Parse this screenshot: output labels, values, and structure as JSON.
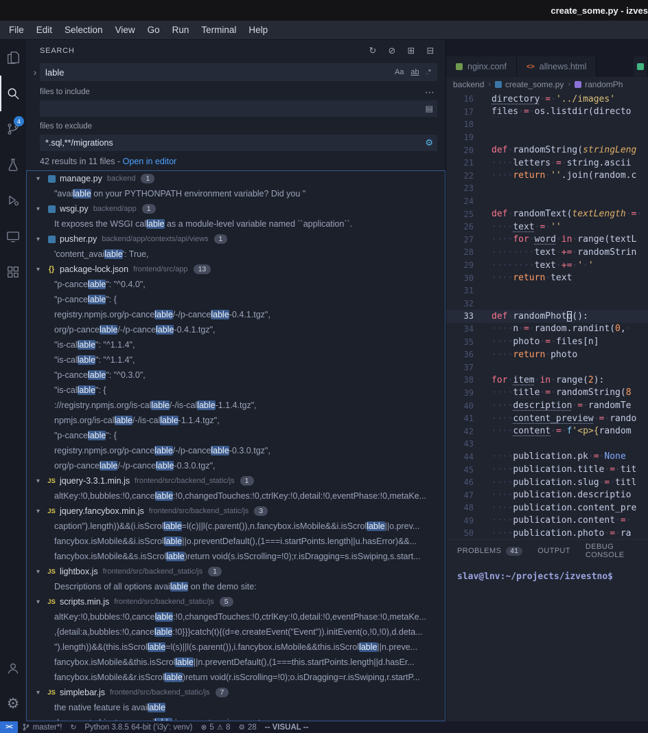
{
  "window": {
    "title": "create_some.py - izves",
    "menus": [
      "File",
      "Edit",
      "Selection",
      "View",
      "Go",
      "Run",
      "Terminal",
      "Help"
    ]
  },
  "activity": {
    "scm_badge": "4"
  },
  "icons": {
    "refresh": "↻",
    "clear_results": "⊘",
    "new_search_editor": "⊞",
    "collapse_all": "⊟",
    "toggle_replace": "›",
    "ellipsis": "⋯",
    "open_editors": "▤",
    "gear": "⚙",
    "match_case": "Aa",
    "whole_word": "ab",
    "regex": ".*",
    "chevron_down": "▾",
    "error": "⊗",
    "warning": "⚠",
    "sync": "↻",
    "remote": "><"
  },
  "search": {
    "panel_title": "SEARCH",
    "query": "lable",
    "include_label": "files to include",
    "include_value": "",
    "exclude_label": "files to exclude",
    "exclude_value": "*.sql,**/migrations",
    "summary": "42 results in 11 files - ",
    "open_in_editor": "Open in editor",
    "results": [
      {
        "type": "py",
        "name": "manage.py",
        "path": "backend",
        "count": "1",
        "matches": [
          "\"available on your PYTHONPATH environment variable? Did you \""
        ]
      },
      {
        "type": "py",
        "name": "wsgi.py",
        "path": "backend/app",
        "count": "1",
        "matches": [
          "It exposes the WSGI callable as a module-level variable named ``application``."
        ]
      },
      {
        "type": "py",
        "name": "pusher.py",
        "path": "backend/app/contexts/api/views",
        "count": "1",
        "matches": [
          "'content_available': True,"
        ]
      },
      {
        "type": "json",
        "name": "package-lock.json",
        "path": "frontend/src/app",
        "count": "13",
        "matches": [
          "\"p-cancelable\": \"^0.4.0\",",
          "\"p-cancelable\": {",
          "registry.npmjs.org/p-cancelable/-/p-cancelable-0.4.1.tgz\",",
          "org/p-cancelable/-/p-cancelable-0.4.1.tgz\",",
          "\"is-callable\": \"^1.1.4\",",
          "\"is-callable\": \"^1.1.4\",",
          "\"p-cancelable\": \"^0.3.0\",",
          "\"is-callable\": {",
          "://registry.npmjs.org/is-callable/-/is-callable-1.1.4.tgz\",",
          "npmjs.org/is-callable/-/is-callable-1.1.4.tgz\",",
          "\"p-cancelable\": {",
          "registry.npmjs.org/p-cancelable/-/p-cancelable-0.3.0.tgz\",",
          "org/p-cancelable/-/p-cancelable-0.3.0.tgz\","
        ]
      },
      {
        "type": "js",
        "name": "jquery-3.3.1.min.js",
        "path": "frontend/src/backend_static/js",
        "count": "1",
        "matches": [
          "altKey:!0,bubbles:!0,cancelable:!0,changedTouches:!0,ctrlKey:!0,detail:!0,eventPhase:!0,metaKe..."
        ]
      },
      {
        "type": "js",
        "name": "jquery.fancybox.min.js",
        "path": "frontend/src/backend_static/js",
        "count": "3",
        "matches": [
          "caption\").length))&&(i.isScrollable=l(c)||l(c.parent()),n.fancybox.isMobile&&i.isScrollable||o.prev...",
          "fancybox.isMobile&&i.isScrollable||o.preventDefault(),(1===i.startPoints.length||u.hasError)&&...",
          "fancybox.isMobile&&s.isScrollable)return void(s.isScrolling=!0);r.isDragging=s.isSwiping,s.start..."
        ]
      },
      {
        "type": "js",
        "name": "lightbox.js",
        "path": "frontend/src/backend_static/js",
        "count": "1",
        "matches": [
          "Descriptions of all options available on the demo site:"
        ]
      },
      {
        "type": "js",
        "name": "scripts.min.js",
        "path": "frontend/src/backend_static/js",
        "count": "5",
        "matches": [
          "altKey:!0,bubbles:!0,cancelable:!0,changedTouches:!0,ctrlKey:!0,detail:!0,eventPhase:!0,metaKe...",
          ",{detail:a,bubbles:!0,cancelable:!0}}}catch(t){(d=e.createEvent(\"Event\")).initEvent(o,!0,!0),d.deta...",
          "\").length))&&(this.isScrollable=l(s)||l(s.parent()),i.fancybox.isMobile&&this.isScrollable||n.preve...",
          "fancybox.isMobile&&this.isScrollable||n.preventDefault(),(1===this.startPoints.length||d.hasEr...",
          "fancybox.isMobile&&r.isScrollable)return void(r.isScrolling=!0);o.isDragging=r.isSwiping,r.startP..."
        ]
      },
      {
        "type": "js",
        "name": "simplebar.js",
        "path": "frontend/src/backend_static/js",
        "count": "7",
        "matches": [
          "the native feature is available",
          "document objects are available in current environment"
        ]
      }
    ]
  },
  "editor": {
    "tabs": [
      {
        "label": "nginx.conf",
        "icon": "nginx",
        "color": "#6f9a4e"
      },
      {
        "label": "allnews.html",
        "icon": "html",
        "color": "#e0703a"
      },
      {
        "label": "",
        "icon": "python",
        "color": "#43b581"
      }
    ],
    "breadcrumb": [
      {
        "label": "backend"
      },
      {
        "label": "create_some.py",
        "icon": "python-file"
      },
      {
        "label": "randomPh",
        "icon": "symbol-method"
      }
    ],
    "lines": [
      {
        "n": 16,
        "t": [
          [
            "vu",
            "directory"
          ],
          [
            "pl",
            " "
          ],
          [
            "op",
            "="
          ],
          [
            "pl",
            " "
          ],
          [
            "st",
            "'../images'"
          ]
        ]
      },
      {
        "n": 17,
        "t": [
          [
            "vu",
            "files"
          ],
          [
            "pl",
            " "
          ],
          [
            "op",
            "="
          ],
          [
            "pl",
            " os.listdir(directo"
          ]
        ]
      },
      {
        "n": 18,
        "t": []
      },
      {
        "n": 19,
        "t": []
      },
      {
        "n": 20,
        "t": [
          [
            "kw",
            "def"
          ],
          [
            "pl",
            " "
          ],
          [
            "fn",
            "randomString"
          ],
          [
            "pl",
            "("
          ],
          [
            "pm",
            "stringLeng"
          ]
        ]
      },
      {
        "n": 21,
        "t": [
          [
            "pl",
            "    letters "
          ],
          [
            "op",
            "="
          ],
          [
            "pl",
            " string.ascii"
          ]
        ]
      },
      {
        "n": 22,
        "t": [
          [
            "pl",
            "    "
          ],
          [
            "kw2",
            "return"
          ],
          [
            "pl",
            " "
          ],
          [
            "st",
            "''"
          ],
          [
            "pl",
            ".join(random.c"
          ]
        ]
      },
      {
        "n": 23,
        "t": []
      },
      {
        "n": 24,
        "t": []
      },
      {
        "n": 25,
        "t": [
          [
            "kw",
            "def"
          ],
          [
            "pl",
            " "
          ],
          [
            "fn",
            "randomText"
          ],
          [
            "pl",
            "("
          ],
          [
            "pm",
            "textLength"
          ],
          [
            "pl",
            " "
          ],
          [
            "op",
            "="
          ],
          [
            "pl",
            " "
          ]
        ]
      },
      {
        "n": 26,
        "t": [
          [
            "pl",
            "    "
          ],
          [
            "vu",
            "text"
          ],
          [
            "pl",
            " "
          ],
          [
            "op",
            "="
          ],
          [
            "pl",
            " "
          ],
          [
            "st",
            "''"
          ]
        ]
      },
      {
        "n": 27,
        "t": [
          [
            "pl",
            "    "
          ],
          [
            "kw",
            "for"
          ],
          [
            "pl",
            " "
          ],
          [
            "vu",
            "word"
          ],
          [
            "pl",
            " "
          ],
          [
            "kw",
            "in"
          ],
          [
            "pl",
            " range(textL"
          ]
        ]
      },
      {
        "n": 28,
        "t": [
          [
            "pl",
            "        text "
          ],
          [
            "op",
            "+="
          ],
          [
            "pl",
            " randomStrin"
          ]
        ]
      },
      {
        "n": 29,
        "t": [
          [
            "pl",
            "        text "
          ],
          [
            "op",
            "+="
          ],
          [
            "pl",
            " "
          ],
          [
            "st",
            "' '"
          ]
        ]
      },
      {
        "n": 30,
        "t": [
          [
            "pl",
            "    "
          ],
          [
            "kw2",
            "return"
          ],
          [
            "pl",
            " text"
          ]
        ]
      },
      {
        "n": 31,
        "t": []
      },
      {
        "n": 32,
        "t": []
      },
      {
        "n": 33,
        "cur": true,
        "t": [
          [
            "kw",
            "def"
          ],
          [
            "pl",
            " "
          ],
          [
            "fn",
            "randomPhot"
          ],
          [
            "cur",
            "o"
          ],
          [
            "pl",
            "():"
          ]
        ]
      },
      {
        "n": 34,
        "t": [
          [
            "pl",
            "    n "
          ],
          [
            "op",
            "="
          ],
          [
            "pl",
            " random.randint("
          ],
          [
            "nu",
            "0"
          ],
          [
            "pl",
            ", "
          ]
        ]
      },
      {
        "n": 35,
        "t": [
          [
            "pl",
            "    photo "
          ],
          [
            "op",
            "="
          ],
          [
            "pl",
            " files[n]"
          ]
        ]
      },
      {
        "n": 36,
        "t": [
          [
            "pl",
            "    "
          ],
          [
            "kw2",
            "return"
          ],
          [
            "pl",
            " photo"
          ]
        ]
      },
      {
        "n": 37,
        "t": []
      },
      {
        "n": 38,
        "t": [
          [
            "kw",
            "for"
          ],
          [
            "pl",
            " "
          ],
          [
            "vu",
            "item"
          ],
          [
            "pl",
            " "
          ],
          [
            "kw",
            "in"
          ],
          [
            "pl",
            " range("
          ],
          [
            "nu",
            "2"
          ],
          [
            "pl",
            "):"
          ]
        ]
      },
      {
        "n": 39,
        "t": [
          [
            "pl",
            "    "
          ],
          [
            "vu",
            "title"
          ],
          [
            "pl",
            " "
          ],
          [
            "op",
            "="
          ],
          [
            "pl",
            " randomString("
          ],
          [
            "nu",
            "8"
          ]
        ]
      },
      {
        "n": 40,
        "t": [
          [
            "pl",
            "    "
          ],
          [
            "vu",
            "description"
          ],
          [
            "pl",
            " "
          ],
          [
            "op",
            "="
          ],
          [
            "pl",
            " randomTe"
          ]
        ]
      },
      {
        "n": 41,
        "t": [
          [
            "pl",
            "    "
          ],
          [
            "vu",
            "content_preview"
          ],
          [
            "pl",
            " "
          ],
          [
            "op",
            "="
          ],
          [
            "pl",
            " rando"
          ]
        ]
      },
      {
        "n": 42,
        "t": [
          [
            "pl",
            "    "
          ],
          [
            "vu",
            "content"
          ],
          [
            "pl",
            " "
          ],
          [
            "op",
            "="
          ],
          [
            "pl",
            " "
          ],
          [
            "fs",
            "f"
          ],
          [
            "st",
            "'<p>{"
          ],
          [
            "pl",
            "random"
          ]
        ]
      },
      {
        "n": 43,
        "t": []
      },
      {
        "n": 44,
        "t": [
          [
            "pl",
            "    publication.pk "
          ],
          [
            "op",
            "="
          ],
          [
            "pl",
            " "
          ],
          [
            "nn",
            "None"
          ]
        ]
      },
      {
        "n": 45,
        "t": [
          [
            "pl",
            "    publication.title "
          ],
          [
            "op",
            "="
          ],
          [
            "pl",
            " tit"
          ]
        ]
      },
      {
        "n": 46,
        "t": [
          [
            "pl",
            "    publication.slug "
          ],
          [
            "op",
            "="
          ],
          [
            "pl",
            " titl"
          ]
        ]
      },
      {
        "n": 47,
        "t": [
          [
            "pl",
            "    publication.descriptio"
          ]
        ]
      },
      {
        "n": 48,
        "t": [
          [
            "pl",
            "    publication.content_pre"
          ]
        ]
      },
      {
        "n": 49,
        "t": [
          [
            "pl",
            "    publication.content "
          ],
          [
            "op",
            "="
          ],
          [
            "pl",
            " "
          ]
        ]
      },
      {
        "n": 50,
        "t": [
          [
            "pl",
            "    publication.photo "
          ],
          [
            "op",
            "="
          ],
          [
            "pl",
            " ra"
          ]
        ]
      }
    ]
  },
  "panel": {
    "tabs": [
      {
        "label": "PROBLEMS",
        "badge": "41"
      },
      {
        "label": "OUTPUT"
      },
      {
        "label": "DEBUG CONSOLE"
      }
    ]
  },
  "terminal": {
    "prompt": "slav@lnv:~/projects/izvestno$"
  },
  "status": {
    "branch": "master*!",
    "python": "Python 3.8.5 64-bit ('i3y': venv)",
    "errors": "5",
    "warnings": "8",
    "misc": "28",
    "mode": "-- VISUAL --"
  },
  "colors": {
    "accent": "#2f6fd6",
    "match_highlight": "#3a5a8c",
    "badge_blue": "#2d7dd2"
  }
}
